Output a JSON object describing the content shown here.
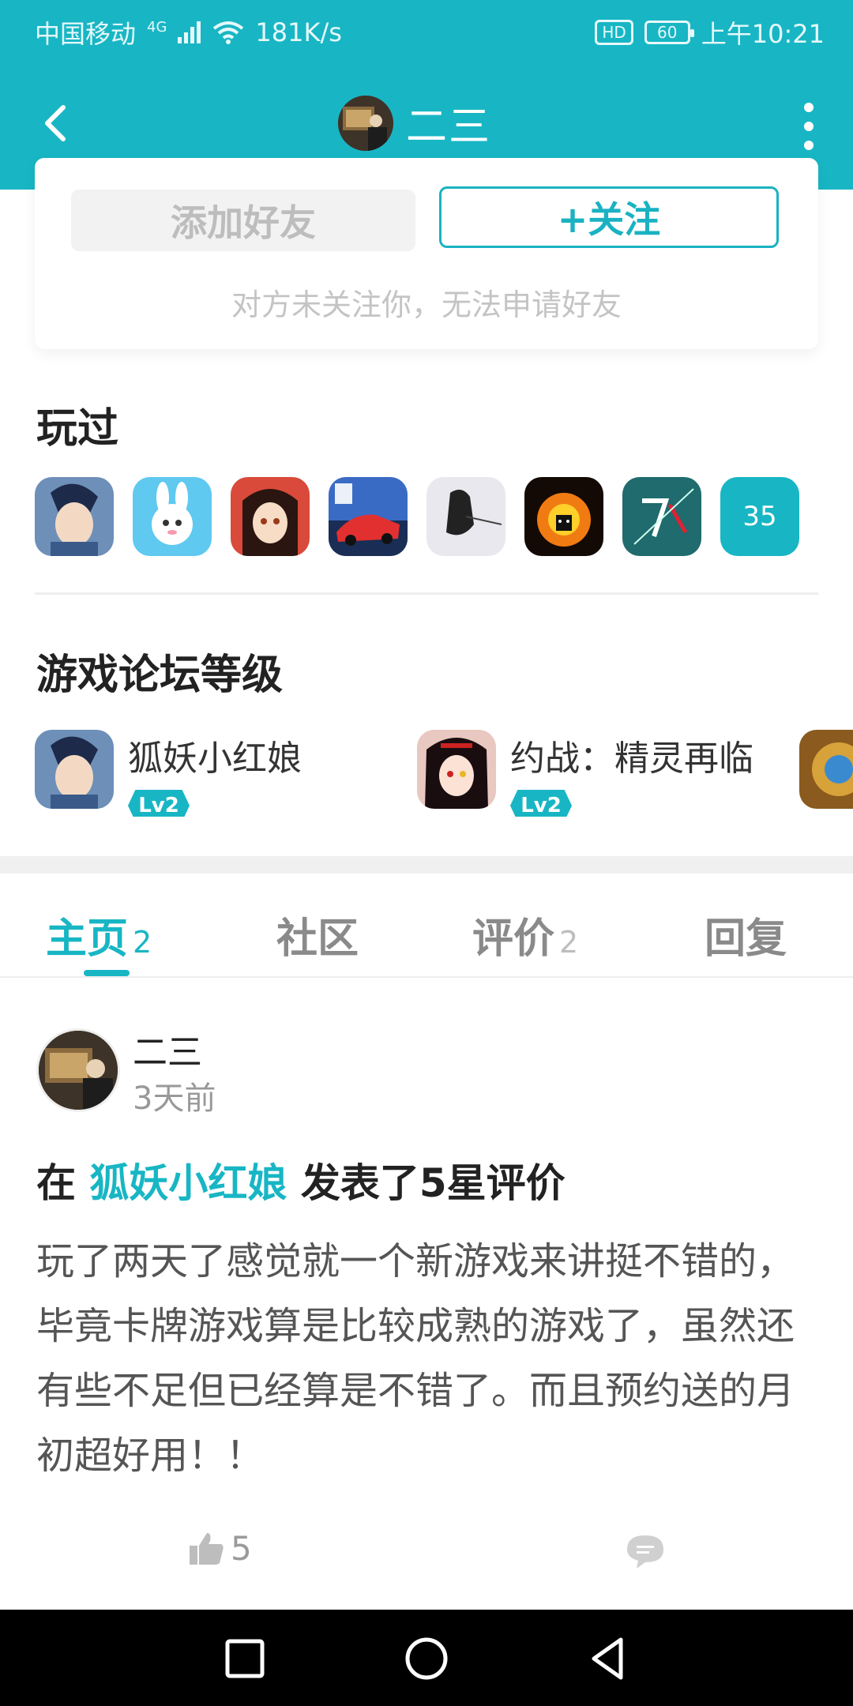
{
  "status_bar": {
    "carrier": "中国移动",
    "network": "4G",
    "speed": "181K/s",
    "hd": "HD",
    "battery": "60",
    "time": "上午10:21"
  },
  "title_bar": {
    "title": "二三"
  },
  "friend_card": {
    "add_friend_label": "添加好友",
    "follow_label": "+关注",
    "note": "对方未关注你，无法申请好友"
  },
  "played": {
    "title": "玩过",
    "count": "35"
  },
  "forum": {
    "title": "游戏论坛等级",
    "items": [
      {
        "name": "狐妖小红娘",
        "level": "Lv2"
      },
      {
        "name": "约战：精灵再临",
        "level": "Lv2"
      }
    ]
  },
  "tabs": [
    {
      "label": "主页",
      "count": "2"
    },
    {
      "label": "社区",
      "count": ""
    },
    {
      "label": "评价",
      "count": "2"
    },
    {
      "label": "回复",
      "count": ""
    }
  ],
  "post": {
    "author": "二三",
    "time": "3天前",
    "prefix": "在",
    "game": "狐妖小红娘",
    "suffix": "发表了5星评价",
    "body": "玩了两天了感觉就一个新游戏来讲挺不错的，毕竟卡牌游戏算是比较成熟的游戏了，虽然还有些不足但已经算是不错了。而且预约送的月初超好用！！",
    "likes": "5"
  },
  "colors": {
    "accent": "#18b6c4",
    "nav_bg": "#000000"
  }
}
